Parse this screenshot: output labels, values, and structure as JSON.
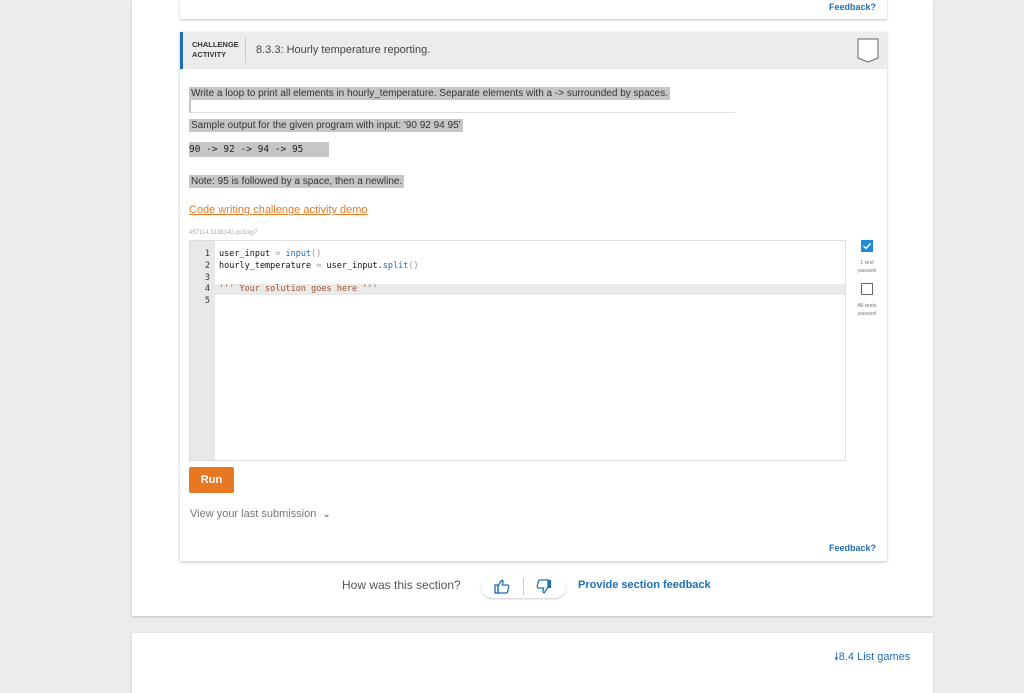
{
  "top_feedback": "Feedback?",
  "activity": {
    "label": "CHALLENGE\nACTIVITY",
    "title": "8.3.3: Hourly temperature reporting.",
    "instruction": "Write a loop to print all elements in hourly_temperature. Separate elements with a -> surrounded by spaces.",
    "sample_label": "Sample output for the given program with input: '90 92 94 95'",
    "sample_output": "90 -> 92 -> 94 -> 95",
    "note": "Note: 95 is followed by a space, then a newline.",
    "demo_link": "Code writing challenge activity demo",
    "code_id": "457114.3138140.qx3zqy7",
    "line_numbers": [
      "1",
      "2",
      "3",
      "4",
      "5"
    ],
    "code": {
      "l1_var": "user_input",
      "l1_op": " = ",
      "l1_fn": "input",
      "l1_paren": "()",
      "l2_var": "hourly_temperature",
      "l2_op": " = ",
      "l2_obj": "user_input.",
      "l2_fn": "split",
      "l2_paren": "()",
      "l4_str": "''' Your solution goes here '''"
    },
    "test1": "1 test passed",
    "test_all": "All tests passed",
    "run_label": "Run",
    "last_submission": "View your last submission",
    "bottom_feedback": "Feedback?",
    "colors": {
      "accent": "#1f6fb4",
      "orange": "#e87722",
      "check": "#1f8ad8"
    }
  },
  "section_feedback": {
    "question": "How was this section?",
    "thumbs_up_icon": "thumbs-up-icon",
    "thumbs_down_icon": "thumbs-down-icon",
    "provide_label": "Provide section feedback"
  },
  "next_section": {
    "label": "8.4 List games"
  }
}
